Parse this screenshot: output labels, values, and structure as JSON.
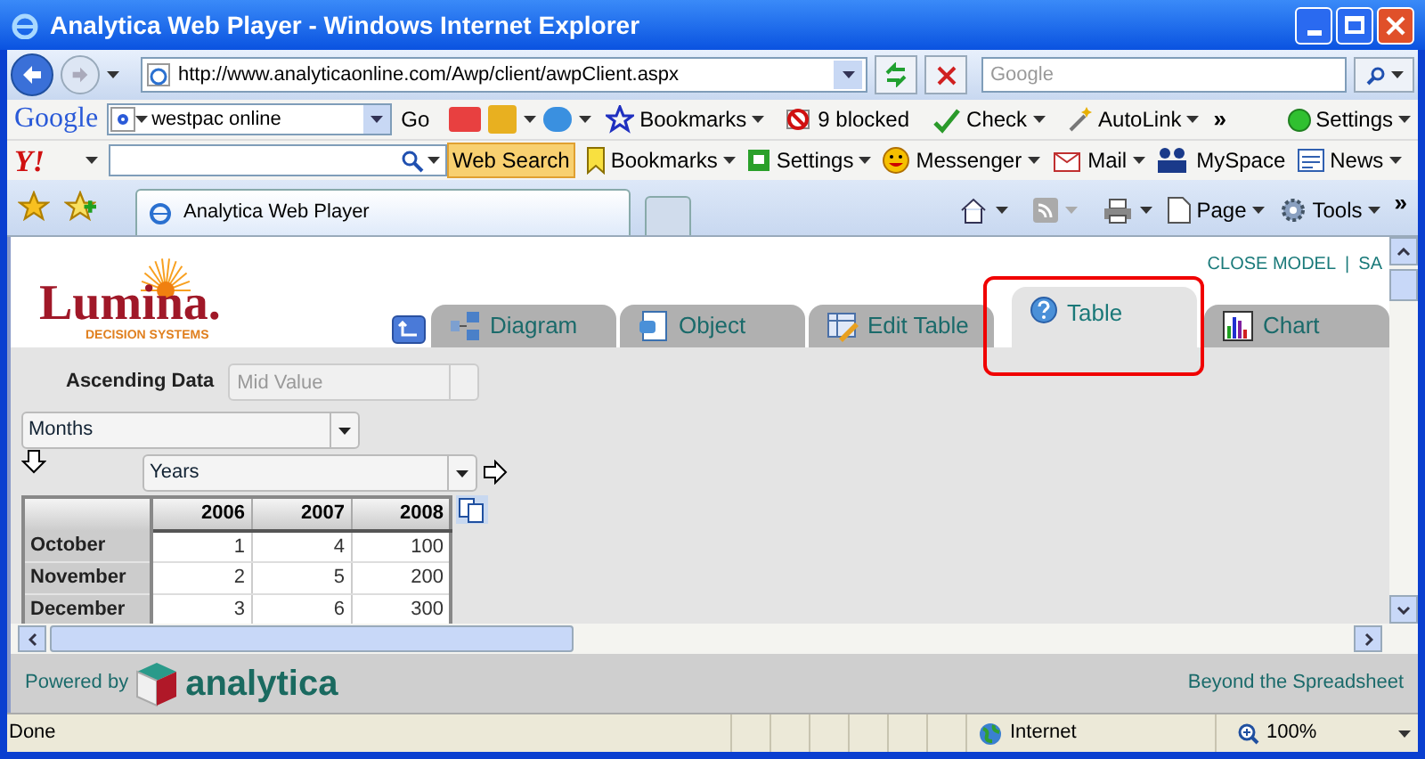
{
  "window": {
    "title": "Analytica Web Player - Windows Internet Explorer"
  },
  "address_bar": {
    "url": "http://www.analyticaonline.com/Awp/client/awpClient.aspx",
    "search_placeholder": "Google"
  },
  "google_toolbar": {
    "brand": "Google",
    "search_value": "westpac online",
    "go": "Go",
    "items": [
      {
        "kind": "bookmarks",
        "label": "Bookmarks"
      },
      {
        "kind": "blocked",
        "label": "9 blocked"
      },
      {
        "kind": "check",
        "label": "Check"
      },
      {
        "kind": "autolink",
        "label": "AutoLink"
      }
    ],
    "more": "»",
    "settings": "Settings"
  },
  "yahoo_toolbar": {
    "brand": "Y!",
    "web_search": "Web Search",
    "items": [
      {
        "kind": "bookmarks",
        "label": "Bookmarks"
      },
      {
        "kind": "settings",
        "label": "Settings"
      },
      {
        "kind": "messenger",
        "label": "Messenger"
      },
      {
        "kind": "mail",
        "label": "Mail"
      },
      {
        "kind": "myspace",
        "label": "MySpace"
      },
      {
        "kind": "news",
        "label": "News"
      }
    ]
  },
  "tab_bar": {
    "tab": "Analytica Web Player",
    "page": "Page",
    "tools": "Tools",
    "more": "»"
  },
  "page": {
    "logo": {
      "name": "Lumina.",
      "tagline": "DECISION SYSTEMS"
    },
    "top_links": [
      "CLOSE MODEL",
      "|",
      "SA"
    ],
    "tabs": [
      {
        "kind": "diagram",
        "label": "Diagram",
        "selected": false
      },
      {
        "kind": "object",
        "label": "Object",
        "selected": false
      },
      {
        "kind": "edit",
        "label": "Edit Table",
        "selected": false
      },
      {
        "kind": "table",
        "label": "Table",
        "selected": true
      },
      {
        "kind": "chart",
        "label": "Chart",
        "selected": false
      }
    ],
    "ascending_label": "Ascending Data",
    "value_field": {
      "placeholder": "Mid Value"
    },
    "row_index": "Months",
    "column_index": "Years",
    "table": {
      "columns": [
        "2006",
        "2007",
        "2008"
      ],
      "rows": [
        {
          "label": "October",
          "cells": [
            "1",
            "4",
            "100"
          ]
        },
        {
          "label": "November",
          "cells": [
            "2",
            "5",
            "200"
          ]
        },
        {
          "label": "December",
          "cells": [
            "3",
            "6",
            "300"
          ]
        }
      ]
    }
  },
  "footer": {
    "powered_by": "Powered by",
    "brand": "analytica",
    "slogan": "Beyond the Spreadsheet"
  },
  "status_bar": {
    "status": "Done",
    "zone": "Internet",
    "zoom": "100%"
  }
}
